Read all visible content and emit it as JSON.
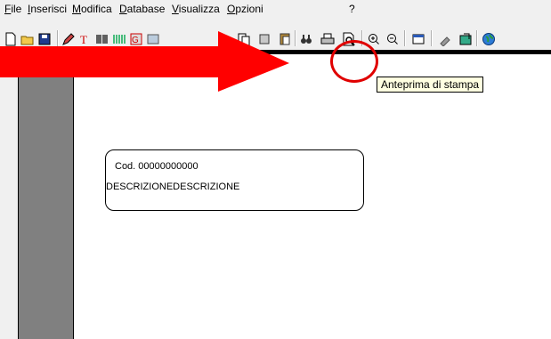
{
  "menu": {
    "file": "File",
    "inserisci": "Inserisci",
    "modifica": "Modifica",
    "database": "Database",
    "visualizza": "Visualizza",
    "opzioni": "Opzioni",
    "help": "?"
  },
  "tooltip": {
    "text": "Anteprima di stampa"
  },
  "label": {
    "code": "Cod. 00000000000",
    "description": "DESCRIZIONEDESCRIZIONE"
  },
  "colors": {
    "highlight_red": "#e00000",
    "tooltip_bg": "#ffffe1",
    "side_panel": "#808080"
  },
  "toolbar": {
    "icons": [
      "new-document-icon",
      "open-folder-icon",
      "save-icon",
      "edit-pen-icon",
      "text-tool-icon",
      "barcode-icon",
      "barcode-alt-icon",
      "graphic-icon",
      "image-icon",
      "copy-icon",
      "cut-icon",
      "paste-icon",
      "binoculars-icon",
      "print-icon",
      "print-preview-icon",
      "zoom-in-icon",
      "zoom-out-icon",
      "window-icon",
      "tool-icon",
      "export-icon",
      "globe-icon"
    ]
  }
}
